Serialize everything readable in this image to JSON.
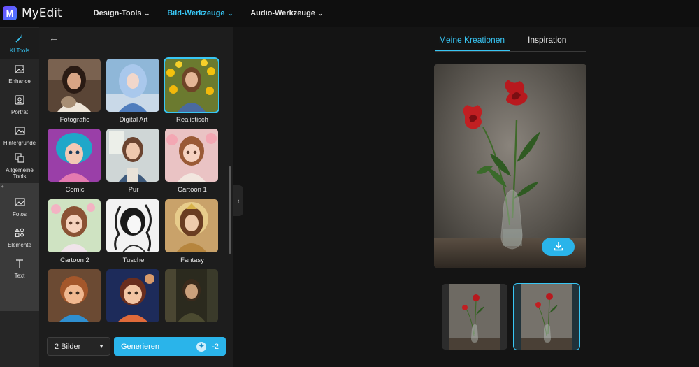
{
  "app": {
    "name": "MyEdit",
    "logo_letter": "M"
  },
  "nav": [
    {
      "label": "Design-Tools",
      "active": false
    },
    {
      "label": "Bild-Werkzeuge",
      "active": true
    },
    {
      "label": "Audio-Werkzeuge",
      "active": false
    }
  ],
  "rail": {
    "ki_tools": "KI Tools",
    "enhance": "Enhance",
    "portrait": "Porträt",
    "backgrounds": "Hintergründe",
    "general_tools": "Allgemeine Tools",
    "photos": "Fotos",
    "elements": "Elemente",
    "text": "Text"
  },
  "styles": [
    {
      "label": "Fotografie",
      "selected": false
    },
    {
      "label": "Digital Art",
      "selected": false
    },
    {
      "label": "Realistisch",
      "selected": true
    },
    {
      "label": "Comic",
      "selected": false
    },
    {
      "label": "Pur",
      "selected": false
    },
    {
      "label": "Cartoon 1",
      "selected": false
    },
    {
      "label": "Cartoon 2",
      "selected": false
    },
    {
      "label": "Tusche",
      "selected": false
    },
    {
      "label": "Fantasy",
      "selected": false
    }
  ],
  "bottom": {
    "count_select": "2 Bilder",
    "generate_label": "Generieren",
    "credit_cost": "-2"
  },
  "right_tabs": [
    {
      "label": "Meine Kreationen",
      "active": true
    },
    {
      "label": "Inspiration",
      "active": false
    }
  ],
  "colors": {
    "accent": "#2ab4ea",
    "accent_text": "#38c6f4",
    "background": "#141414"
  }
}
